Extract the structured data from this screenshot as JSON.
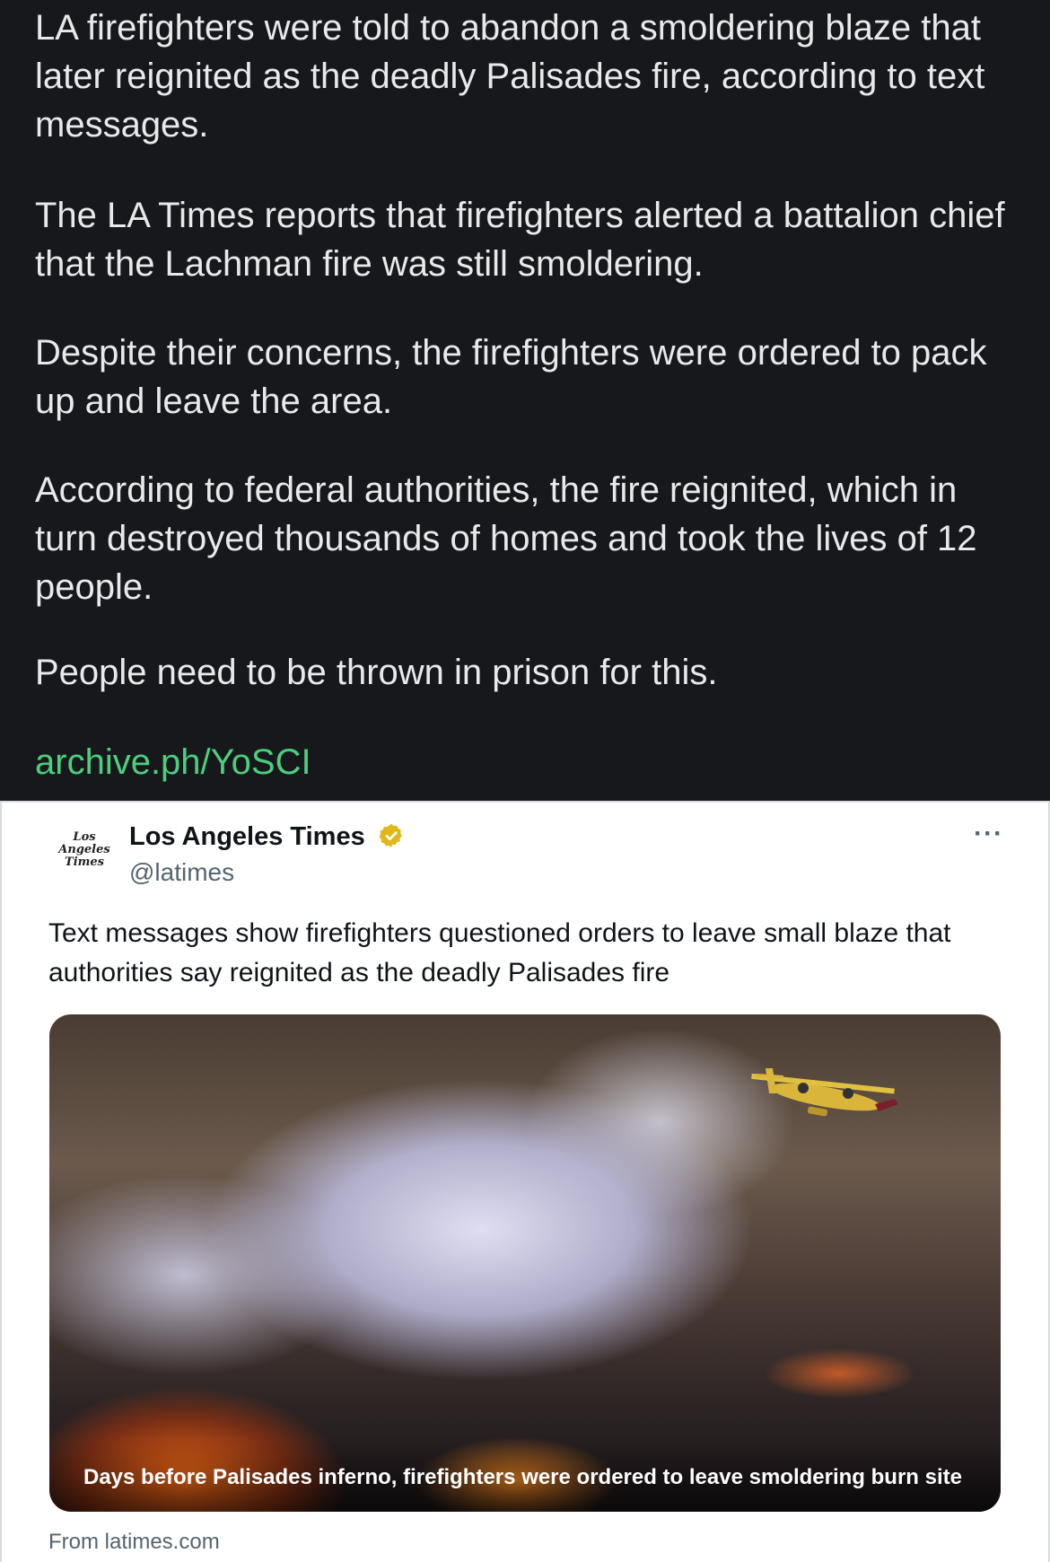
{
  "post": {
    "paragraphs": [
      "LA firefighters were told to abandon a smoldering blaze that later reignited as the deadly Palisades fire, according to text messages.",
      "The LA Times reports that firefighters alerted a battalion chief that the Lachman fire was still smoldering.",
      "Despite their concerns, the firefighters were ordered to pack up and leave the area.",
      "According to federal authorities, the fire reignited, which in turn destroyed thousands of homes and took the lives of 12 people.",
      "People need to be thrown in prison for this."
    ],
    "link": "archive.ph/YoSCI",
    "link_color": "#4cce7c"
  },
  "embed": {
    "logo_lines": [
      "Los",
      "Angeles",
      "Times"
    ],
    "name": "Los Angeles Times",
    "handle": "@latimes",
    "verified_badge": "gold-verified-icon",
    "more": "···",
    "text": "Text messages show firefighters questioned orders to leave small blaze that authorities say reignited as the deadly Palisades fire",
    "media_caption": "Days before Palisades inferno, firefighters were ordered to leave smoldering burn site",
    "source": "From latimes.com"
  }
}
